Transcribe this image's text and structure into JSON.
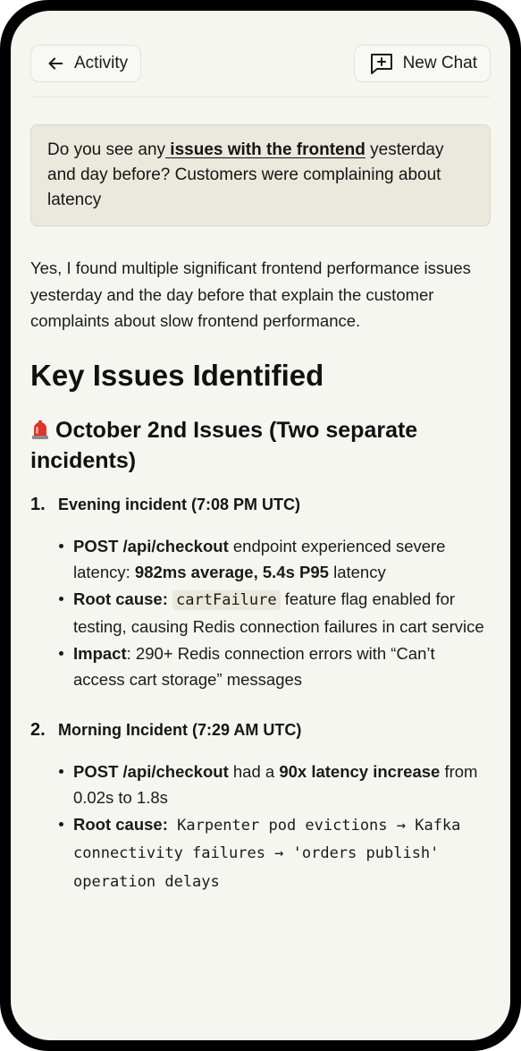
{
  "header": {
    "back_label": "Activity",
    "new_chat_label": "New Chat"
  },
  "prompt": {
    "pre": "Do you see any",
    "highlight": " issues with the frontend",
    "post": " yesterday and day before? Customers were complaining about latency"
  },
  "answer": {
    "intro": "Yes, I found multiple significant frontend performance issues yesterday and the day before that explain the customer complaints about slow frontend performance.",
    "heading": "Key Issues Identified",
    "subheading": "October 2nd Issues (Two separate incidents)",
    "siren_icon": "rotating-light-icon",
    "incidents": [
      {
        "number": "1.",
        "title": "Evening incident (7:08 PM UTC)",
        "bullets": [
          {
            "b1_bold": "POST /api/checkout",
            "b1_text": " endpoint experienced severe latency: ",
            "b1_bold2": "982ms average, 5.4s P95",
            "b1_text2": " latency"
          },
          {
            "b2_bold": "Root cause:",
            "b2_code": "cartFailure",
            "b2_text": " feature flag enabled for testing, causing Redis connection failures in cart service"
          },
          {
            "b3_bold": "Impact",
            "b3_text": ": 290+ Redis connection errors with “Can’t access cart storage” messages"
          }
        ]
      },
      {
        "number": "2.",
        "title": "Morning Incident (7:29 AM UTC)",
        "bullets": [
          {
            "b1_bold": "POST /api/checkout",
            "b1_text": " had a ",
            "b1_bold2": "90x latency increase",
            "b1_text2": " from 0.02s to 1.8s"
          },
          {
            "b2_bold": "Root cause:",
            "b2_mono": " Karpenter pod evictions → Kafka connectivity failures → 'orders publish' operation delays"
          }
        ]
      }
    ]
  },
  "colors": {
    "screen_bg": "#f6f6f1",
    "prompt_bg": "#e9e9de",
    "frame": "#000000"
  }
}
